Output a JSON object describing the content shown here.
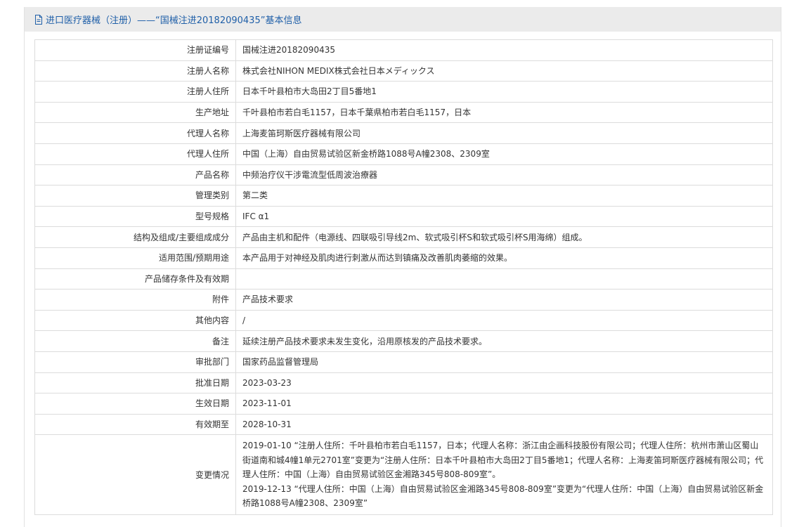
{
  "header": {
    "title": "进口医疗器械（注册）——“国械注进20182090435”基本信息",
    "accent_color": "#1f5fa8"
  },
  "rows": [
    {
      "label": "注册证编号",
      "value": "国械注进20182090435"
    },
    {
      "label": "注册人名称",
      "value": "株式会社NIHON MEDIX株式会社日本メディックス"
    },
    {
      "label": "注册人住所",
      "value": "日本千叶县柏市大岛田2丁目5番地1"
    },
    {
      "label": "生产地址",
      "value": "千叶县柏市若白毛1157，日本千葉県柏市若白毛1157，日本"
    },
    {
      "label": "代理人名称",
      "value": "上海麦笛珂斯医疗器械有限公司"
    },
    {
      "label": "代理人住所",
      "value": "中国（上海）自由贸易试验区新金桥路1088号A幢2308、2309室"
    },
    {
      "label": "产品名称",
      "value": "中频治疗仪干涉電流型低周波治療器"
    },
    {
      "label": "管理类别",
      "value": "第二类"
    },
    {
      "label": "型号规格",
      "value": "IFC α1"
    },
    {
      "label": "结构及组成/主要组成成分",
      "value": "产品由主机和配件（电源线、四联吸引导线2m、软式吸引杯S和软式吸引杯S用海绵）组成。"
    },
    {
      "label": "适用范围/预期用途",
      "value": "本产品用于对神经及肌肉进行刺激从而达到镇痛及改善肌肉萎缩的效果。"
    },
    {
      "label": "产品储存条件及有效期",
      "value": ""
    },
    {
      "label": "附件",
      "value": "产品技术要求"
    },
    {
      "label": "其他内容",
      "value": "/"
    },
    {
      "label": "备注",
      "value": "延续注册产品技术要求未发生变化，沿用原核发的产品技术要求。"
    },
    {
      "label": "审批部门",
      "value": "国家药品监督管理局"
    },
    {
      "label": "批准日期",
      "value": "2023-03-23"
    },
    {
      "label": "生效日期",
      "value": "2023-11-01"
    },
    {
      "label": "有效期至",
      "value": "2028-10-31"
    }
  ],
  "changes": {
    "label": "变更情况",
    "entries": [
      "2019-01-10 “注册人住所：千叶县柏市若白毛1157，日本；代理人名称：浙江由企画科技股份有限公司；代理人住所：杭州市萧山区蜀山街道南和城4幢1单元2701室”变更为“注册人住所：日本千叶县柏市大岛田2丁目5番地1；代理人名称：上海麦笛珂斯医疗器械有限公司；代理人住所：中国（上海）自由贸易试验区金湘路345号808-809室”。",
      "2019-12-13 “代理人住所：中国（上海）自由贸易试验区金湘路345号808-809室”变更为“代理人住所：中国（上海）自由贸易试验区新金桥路1088号A幢2308、2309室”"
    ]
  }
}
